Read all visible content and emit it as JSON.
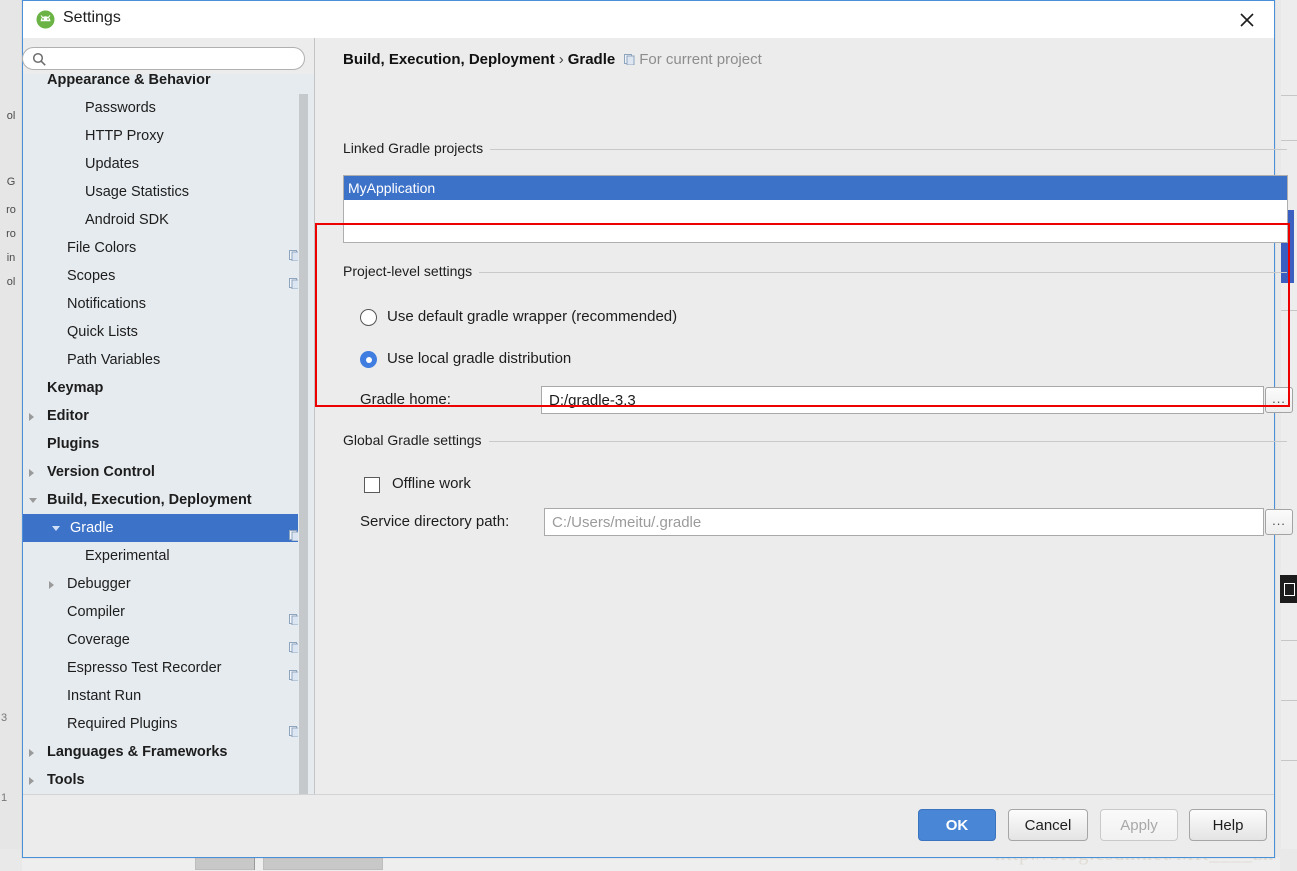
{
  "window": {
    "title": "Settings",
    "app_icon": "android-studio-icon",
    "close_icon": "close-icon"
  },
  "sidebar": {
    "search": {
      "value": "",
      "placeholder": "",
      "icon": "search-icon"
    },
    "items": [
      {
        "label": "Appearance & Behavior",
        "indent": 24,
        "bold": true,
        "arrow": "none",
        "copy": false,
        "selected": false,
        "clipped": "top"
      },
      {
        "label": "Passwords",
        "indent": 62,
        "bold": false,
        "arrow": "none",
        "copy": false,
        "selected": false
      },
      {
        "label": "HTTP Proxy",
        "indent": 62,
        "bold": false,
        "arrow": "none",
        "copy": false,
        "selected": false
      },
      {
        "label": "Updates",
        "indent": 62,
        "bold": false,
        "arrow": "none",
        "copy": false,
        "selected": false
      },
      {
        "label": "Usage Statistics",
        "indent": 62,
        "bold": false,
        "arrow": "none",
        "copy": false,
        "selected": false
      },
      {
        "label": "Android SDK",
        "indent": 62,
        "bold": false,
        "arrow": "none",
        "copy": false,
        "selected": false
      },
      {
        "label": "File Colors",
        "indent": 44,
        "bold": false,
        "arrow": "none",
        "copy": true,
        "selected": false
      },
      {
        "label": "Scopes",
        "indent": 44,
        "bold": false,
        "arrow": "none",
        "copy": true,
        "selected": false
      },
      {
        "label": "Notifications",
        "indent": 44,
        "bold": false,
        "arrow": "none",
        "copy": false,
        "selected": false
      },
      {
        "label": "Quick Lists",
        "indent": 44,
        "bold": false,
        "arrow": "none",
        "copy": false,
        "selected": false
      },
      {
        "label": "Path Variables",
        "indent": 44,
        "bold": false,
        "arrow": "none",
        "copy": false,
        "selected": false
      },
      {
        "label": "Keymap",
        "indent": 24,
        "bold": true,
        "arrow": "none",
        "copy": false,
        "selected": false
      },
      {
        "label": "Editor",
        "indent": 24,
        "bold": true,
        "arrow": "right",
        "copy": false,
        "selected": false
      },
      {
        "label": "Plugins",
        "indent": 24,
        "bold": true,
        "arrow": "none",
        "copy": false,
        "selected": false
      },
      {
        "label": "Version Control",
        "indent": 24,
        "bold": true,
        "arrow": "right",
        "copy": false,
        "selected": false
      },
      {
        "label": "Build, Execution, Deployment",
        "indent": 24,
        "bold": true,
        "arrow": "down",
        "copy": false,
        "selected": false
      },
      {
        "label": "Gradle",
        "indent": 47,
        "bold": false,
        "arrow": "down",
        "copy": true,
        "selected": true
      },
      {
        "label": "Experimental",
        "indent": 62,
        "bold": false,
        "arrow": "none",
        "copy": false,
        "selected": false
      },
      {
        "label": "Debugger",
        "indent": 44,
        "bold": false,
        "arrow": "right",
        "copy": false,
        "selected": false
      },
      {
        "label": "Compiler",
        "indent": 44,
        "bold": false,
        "arrow": "none",
        "copy": true,
        "selected": false
      },
      {
        "label": "Coverage",
        "indent": 44,
        "bold": false,
        "arrow": "none",
        "copy": true,
        "selected": false
      },
      {
        "label": "Espresso Test Recorder",
        "indent": 44,
        "bold": false,
        "arrow": "none",
        "copy": true,
        "selected": false
      },
      {
        "label": "Instant Run",
        "indent": 44,
        "bold": false,
        "arrow": "none",
        "copy": false,
        "selected": false
      },
      {
        "label": "Required Plugins",
        "indent": 44,
        "bold": false,
        "arrow": "none",
        "copy": true,
        "selected": false
      },
      {
        "label": "Languages & Frameworks",
        "indent": 24,
        "bold": true,
        "arrow": "right",
        "copy": false,
        "selected": false
      },
      {
        "label": "Tools",
        "indent": 24,
        "bold": true,
        "arrow": "right",
        "copy": false,
        "selected": false
      }
    ]
  },
  "main": {
    "breadcrumb": {
      "parent": "Build, Execution, Deployment",
      "separator": "›",
      "current": "Gradle",
      "scope_label": "For current project",
      "scope_icon": "project-scope-icon"
    },
    "linked_projects": {
      "group_label": "Linked Gradle projects",
      "items": [
        "MyApplication"
      ]
    },
    "project_level": {
      "group_label": "Project-level settings",
      "radio_wrapper": {
        "label": "Use default gradle wrapper (recommended)",
        "selected": false
      },
      "radio_local": {
        "label": "Use local gradle distribution",
        "selected": true
      },
      "gradle_home": {
        "label": "Gradle home:",
        "value": "D:/gradle-3.3",
        "placeholder": "",
        "browse_label": "..."
      }
    },
    "global_settings": {
      "group_label": "Global Gradle settings",
      "offline_work": {
        "label": "Offline work",
        "checked": false
      },
      "service_directory": {
        "label": "Service directory path:",
        "value": "",
        "placeholder": "C:/Users/meitu/.gradle",
        "browse_label": "..."
      }
    },
    "highlight_color": "#ec0000"
  },
  "footer": {
    "ok": "OK",
    "cancel": "Cancel",
    "apply": "Apply",
    "help": "Help",
    "apply_disabled": true
  },
  "background": {
    "watermark": "http://blog.csdn.net/MR____zh",
    "left_tabs": [
      "ol",
      "G",
      "ro",
      "ro",
      "in",
      "ol"
    ],
    "gutter_numbers": [
      "3",
      "1"
    ]
  }
}
